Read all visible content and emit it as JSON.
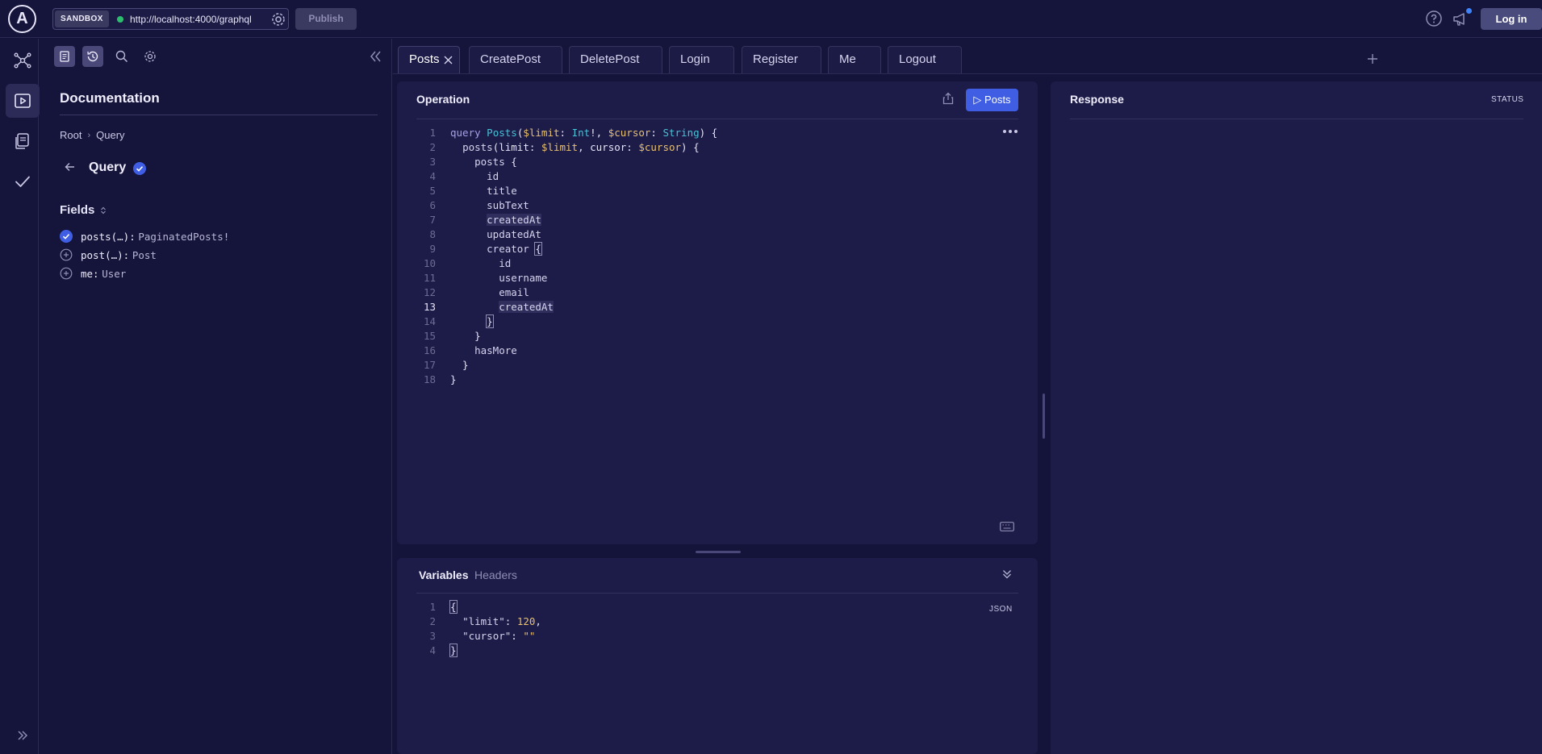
{
  "topbar": {
    "logo_letter": "A",
    "sandbox_label": "SANDBOX",
    "endpoint_url": "http://localhost:4000/graphql",
    "publish_label": "Publish",
    "login_label": "Log in"
  },
  "rail": {
    "icons": [
      "schema-graph-icon",
      "explorer-play-icon",
      "pages-icon",
      "checks-icon",
      "expand-sidebar-icon"
    ],
    "active": "explorer-play-icon"
  },
  "docs": {
    "title": "Documentation",
    "breadcrumb": [
      "Root",
      "Query"
    ],
    "type_name": "Query",
    "fields_label": "Fields",
    "fields": [
      {
        "name": "posts(…):",
        "type": "PaginatedPosts!",
        "selected": true
      },
      {
        "name": "post(…):",
        "type": "Post",
        "selected": false
      },
      {
        "name": "me:",
        "type": "User",
        "selected": false
      }
    ]
  },
  "tabs": {
    "items": [
      "Posts",
      "CreatePost",
      "DeletePost",
      "Login",
      "Register",
      "Me",
      "Logout"
    ],
    "active": "Posts"
  },
  "operation": {
    "title": "Operation",
    "run_label": "Posts",
    "current_line": 13,
    "lines": [
      "query Posts($limit: Int!, $cursor: String) {",
      "  posts(limit: $limit, cursor: $cursor) {",
      "    posts {",
      "      id",
      "      title",
      "      subText",
      "      createdAt",
      "      updatedAt",
      "      creator {",
      "        id",
      "        username",
      "        email",
      "        createdAt",
      "      }",
      "    }",
      "    hasMore",
      "  }",
      "}"
    ]
  },
  "variables": {
    "tab_variables": "Variables",
    "tab_headers": "Headers",
    "format_label": "JSON",
    "lines": [
      "{",
      "  \"limit\": 120,",
      "  \"cursor\": \"\"",
      "}"
    ]
  },
  "response": {
    "title": "Response",
    "status_label": "STATUS"
  },
  "colors": {
    "background": "#14133a",
    "panel": "#1d1c48",
    "accent": "#3f5ee3",
    "keyword": "#a59fe8",
    "variable": "#e7c070",
    "type": "#46c2d6"
  }
}
